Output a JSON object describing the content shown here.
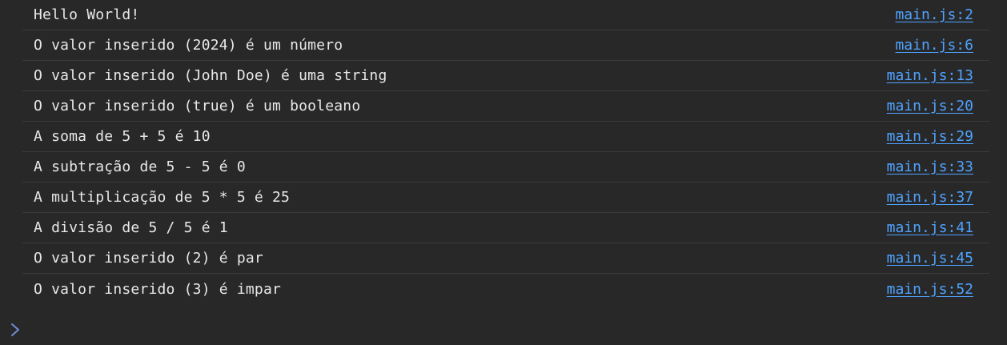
{
  "console": {
    "logs": [
      {
        "message": "Hello World!",
        "source": "main.js:2"
      },
      {
        "message": "O valor inserido (2024) é um número",
        "source": "main.js:6"
      },
      {
        "message": "O valor inserido (John Doe) é uma string",
        "source": "main.js:13"
      },
      {
        "message": "O valor inserido (true) é um booleano",
        "source": "main.js:20"
      },
      {
        "message": "A soma de 5 + 5 é 10",
        "source": "main.js:29"
      },
      {
        "message": "A subtração de 5 - 5 é 0",
        "source": "main.js:33"
      },
      {
        "message": "A multiplicação de 5 * 5 é 25",
        "source": "main.js:37"
      },
      {
        "message": "A divisão de 5 / 5 é 1",
        "source": "main.js:41"
      },
      {
        "message": "O valor inserido (2) é par",
        "source": "main.js:45"
      },
      {
        "message": "O valor inserido (3) é impar",
        "source": "main.js:52"
      }
    ],
    "prompt": {
      "icon": "chevron-right-icon",
      "value": ""
    }
  },
  "colors": {
    "background": "#282828",
    "text": "#e8e8e8",
    "link": "#4fa3ff",
    "divider": "#3a3a3a",
    "prompt_icon": "#6f8fd6"
  }
}
